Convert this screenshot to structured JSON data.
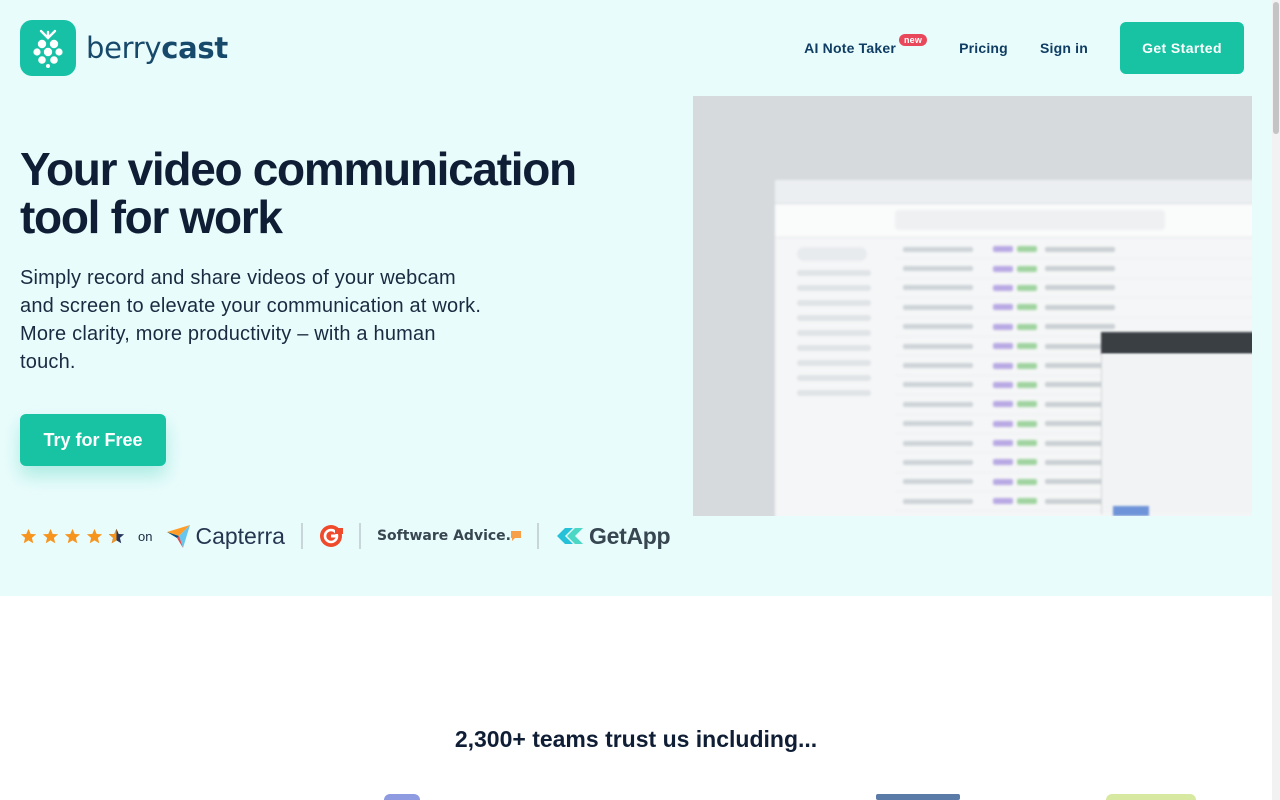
{
  "header": {
    "logo_text_light": "berry",
    "logo_text_bold": "cast",
    "nav": {
      "ai_note_taker": "AI Note Taker",
      "ai_badge": "new",
      "pricing": "Pricing",
      "sign_in": "Sign in"
    },
    "cta": "Get Started"
  },
  "hero": {
    "headline": "Your video communication tool for work",
    "subtext": "Simply record and share videos of your webcam and screen to elevate your communication at work. More clarity, more productivity – with a human touch.",
    "cta": "Try for Free",
    "rating": {
      "stars": 4.5,
      "on_label": "on",
      "sites": [
        "Capterra",
        "G2",
        "Software Advice.",
        "GetApp"
      ]
    }
  },
  "trust": {
    "heading": "2,300+ teams trust us including..."
  },
  "colors": {
    "accent": "#17c3a3",
    "hero_bg": "#e9fcfc",
    "heading": "#0f1e35",
    "nav_text": "#0f3d63",
    "badge": "#e9485b",
    "star": "#f7941d"
  }
}
